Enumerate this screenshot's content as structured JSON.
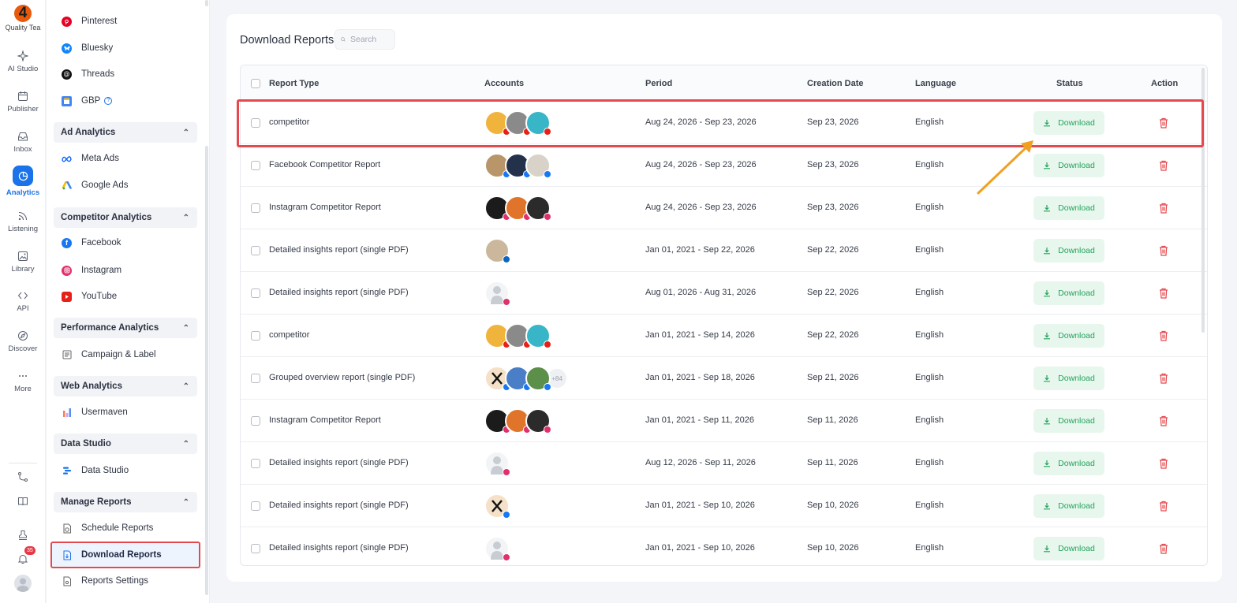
{
  "rail": {
    "logo_text": "Quality Tea",
    "items": [
      {
        "label": "AI Studio"
      },
      {
        "label": "Publisher"
      },
      {
        "label": "Inbox"
      },
      {
        "label": "Analytics"
      },
      {
        "label": "Listening"
      },
      {
        "label": "Library"
      },
      {
        "label": "API"
      },
      {
        "label": "Discover"
      },
      {
        "label": "More"
      }
    ],
    "notification_count": "35"
  },
  "sidebar": {
    "social_items": [
      {
        "label": "Pinterest"
      },
      {
        "label": "Bluesky"
      },
      {
        "label": "Threads"
      },
      {
        "label": "GBP"
      }
    ],
    "sections": [
      {
        "title": "Ad Analytics",
        "items": [
          {
            "label": "Meta Ads"
          },
          {
            "label": "Google Ads"
          }
        ]
      },
      {
        "title": "Competitor Analytics",
        "items": [
          {
            "label": "Facebook"
          },
          {
            "label": "Instagram"
          },
          {
            "label": "YouTube"
          }
        ]
      },
      {
        "title": "Performance Analytics",
        "items": [
          {
            "label": "Campaign & Label"
          }
        ]
      },
      {
        "title": "Web Analytics",
        "items": [
          {
            "label": "Usermaven"
          }
        ]
      },
      {
        "title": "Data Studio",
        "items": [
          {
            "label": "Data Studio"
          }
        ]
      },
      {
        "title": "Manage Reports",
        "items": [
          {
            "label": "Schedule Reports"
          },
          {
            "label": "Download Reports"
          },
          {
            "label": "Reports Settings"
          }
        ]
      }
    ]
  },
  "main": {
    "title": "Download Reports",
    "search_placeholder": "Search",
    "columns": [
      "Report Type",
      "Accounts",
      "Period",
      "Creation Date",
      "Language",
      "Status",
      "Action"
    ],
    "download_label": "Download",
    "rows": [
      {
        "type": "competitor",
        "period": "Aug 24, 2026 - Sep 23, 2026",
        "created": "Sep 23, 2026",
        "language": "English",
        "more": ""
      },
      {
        "type": "Facebook Competitor Report",
        "period": "Aug 24, 2026 - Sep 23, 2026",
        "created": "Sep 23, 2026",
        "language": "English",
        "more": ""
      },
      {
        "type": "Instagram Competitor Report",
        "period": "Aug 24, 2026 - Sep 23, 2026",
        "created": "Sep 23, 2026",
        "language": "English",
        "more": ""
      },
      {
        "type": "Detailed insights report (single PDF)",
        "period": "Jan 01, 2021 - Sep 22, 2026",
        "created": "Sep 22, 2026",
        "language": "English",
        "more": ""
      },
      {
        "type": "Detailed insights report (single PDF)",
        "period": "Aug 01, 2026 - Aug 31, 2026",
        "created": "Sep 22, 2026",
        "language": "English",
        "more": ""
      },
      {
        "type": "competitor",
        "period": "Jan 01, 2021 - Sep 14, 2026",
        "created": "Sep 22, 2026",
        "language": "English",
        "more": ""
      },
      {
        "type": "Grouped overview report (single PDF)",
        "period": "Jan 01, 2021 - Sep 18, 2026",
        "created": "Sep 21, 2026",
        "language": "English",
        "more": "+84"
      },
      {
        "type": "Instagram Competitor Report",
        "period": "Jan 01, 2021 - Sep 11, 2026",
        "created": "Sep 11, 2026",
        "language": "English",
        "more": ""
      },
      {
        "type": "Detailed insights report (single PDF)",
        "period": "Aug 12, 2026 - Sep 11, 2026",
        "created": "Sep 11, 2026",
        "language": "English",
        "more": ""
      },
      {
        "type": "Detailed insights report (single PDF)",
        "period": "Jan 01, 2021 - Sep 10, 2026",
        "created": "Sep 10, 2026",
        "language": "English",
        "more": ""
      },
      {
        "type": "Detailed insights report (single PDF)",
        "period": "Jan 01, 2021 - Sep 10, 2026",
        "created": "Sep 10, 2026",
        "language": "English",
        "more": ""
      }
    ]
  },
  "colors": {
    "accent": "#1a73e8",
    "download_green": "#23a45a",
    "download_bg": "#e8f7ee",
    "delete_red": "#e5484d",
    "highlight_red": "#e5484d",
    "arrow_orange": "#f0a020"
  }
}
